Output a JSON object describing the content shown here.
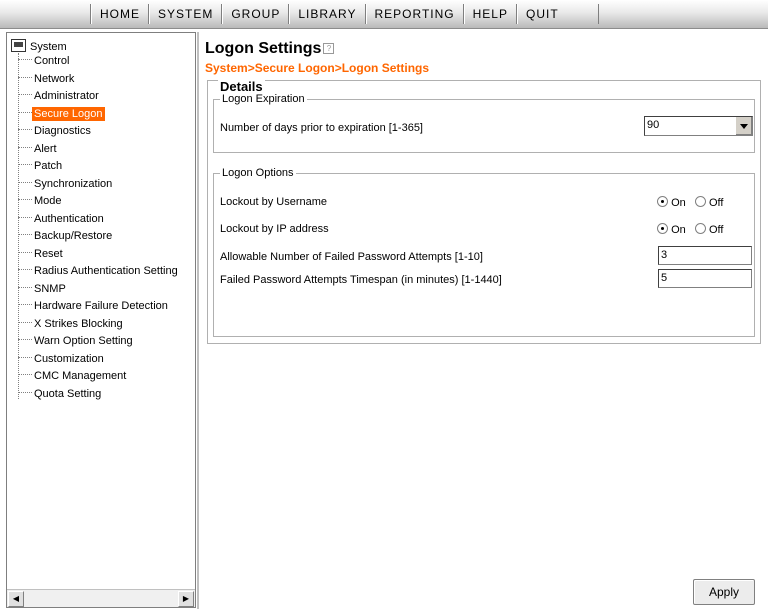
{
  "menu": [
    "HOME",
    "SYSTEM",
    "GROUP",
    "LIBRARY",
    "REPORTING",
    "HELP",
    "QUIT"
  ],
  "tree": {
    "root": "System",
    "items": [
      "Control",
      "Network",
      "Administrator",
      "Secure Logon",
      "Diagnostics",
      "Alert",
      "Patch",
      "Synchronization",
      "Mode",
      "Authentication",
      "Backup/Restore",
      "Reset",
      "Radius Authentication Setting",
      "SNMP",
      "Hardware Failure Detection",
      "X Strikes Blocking",
      "Warn Option Setting",
      "Customization",
      "CMC Management",
      "Quota Setting"
    ],
    "active": "Secure Logon"
  },
  "page": {
    "title": "Logon Settings",
    "breadcrumb": "System>Secure Logon>Logon Settings",
    "details_label": "Details"
  },
  "expiration": {
    "label": "Logon Expiration",
    "days_label": "Number of days prior to expiration [1-365]",
    "days_value": "90"
  },
  "options": {
    "label": "Logon Options",
    "lockout_username_label": "Lockout by Username",
    "lockout_ip_label": "Lockout by IP address",
    "on_label": "On",
    "off_label": "Off",
    "lockout_username_value": "On",
    "lockout_ip_value": "On",
    "failed_attempts_label": "Allowable Number of Failed Password Attempts [1-10]",
    "failed_attempts_value": "3",
    "timespan_label": "Failed Password Attempts Timespan (in minutes) [1-1440]",
    "timespan_value": "5"
  },
  "apply_label": "Apply",
  "colors": {
    "accent": "#ff6600",
    "selected_bg": "#ff6600"
  },
  "icons": [
    "computer-icon",
    "help-icon",
    "dropdown-arrow-icon",
    "scroll-left-icon",
    "scroll-right-icon"
  ]
}
